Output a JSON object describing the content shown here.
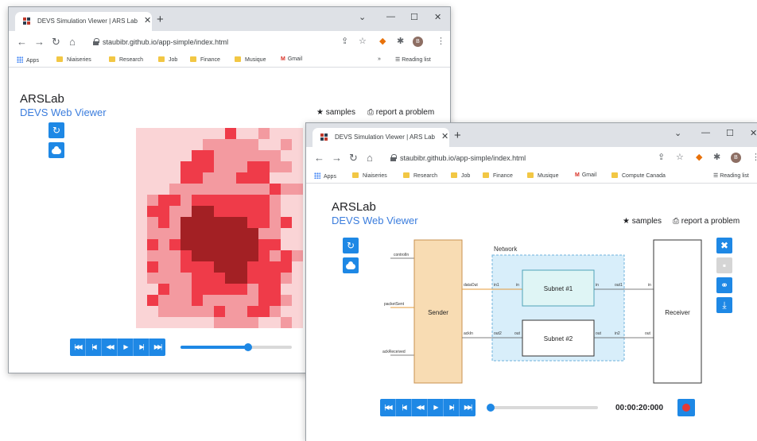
{
  "colors": {
    "accent": "#1e88e5",
    "sender_fill": "#f8dcb3",
    "network_fill": "#d8eefa",
    "subnet1_fill": "#dff5f5",
    "cell_dark": "#a32024",
    "cell_mid": "#ef3b49",
    "cell_light": "#f39aa0",
    "cell_pale": "#fad4d6"
  },
  "back_window": {
    "tab_title": "DEVS Simulation Viewer | ARS Lab",
    "url": "staubibr.github.io/app-simple/index.html",
    "bookmarks": [
      "Apps",
      "Niaiseries",
      "Research",
      "Job",
      "Finance",
      "Musique",
      "Gmail"
    ],
    "reading_list": "Reading list",
    "brand": "ARSLab",
    "subtitle": "DEVS Web Viewer",
    "samples_label": "samples",
    "report_label": "report a problem",
    "slider_value": 0.61,
    "grid_cols": 15,
    "grid_rows": 18,
    "grid": [
      "000000002001000",
      "000000111110010",
      "000002211111100",
      "000022211122110",
      "000022111222000",
      "000111111111211",
      "012212222222100",
      "022113322222100",
      "012133333322120",
      "011133333331100",
      "021233333332200",
      "011123333332121",
      "021122233322220",
      "011112223322210",
      "002112222212200",
      "021112111112210",
      "001111121122100",
      "000000011110010"
    ]
  },
  "front_window": {
    "tab_title": "DEVS Simulation Viewer | ARS Lab",
    "url": "staubibr.github.io/app-simple/index.html",
    "bookmarks": [
      "Apps",
      "Niaiseries",
      "Research",
      "Job",
      "Finance",
      "Musique",
      "Gmail",
      "Compute Canada"
    ],
    "reading_list": "Reading list",
    "brand": "ARSLab",
    "subtitle": "DEVS Web Viewer",
    "samples_label": "samples",
    "report_label": "report a problem",
    "diagram": {
      "network_label": "Network",
      "sender_label": "Sender",
      "receiver_label": "Receiver",
      "subnet1_label": "Subnet #1",
      "subnet2_label": "Subnet #2",
      "sender_inputs": [
        "controlIn",
        "packetSent",
        "ackReceived"
      ],
      "sender_outputs": [
        "dataOut",
        "ackIn"
      ],
      "network_ports": [
        "in1",
        "out2"
      ],
      "subnet_ports": [
        "in",
        "out",
        "in",
        "out"
      ],
      "network_out_ports": [
        "out1",
        "in2"
      ],
      "receiver_ports": [
        "in",
        "out"
      ]
    },
    "time": "00:00:20:000",
    "slider_value": 0.0
  }
}
